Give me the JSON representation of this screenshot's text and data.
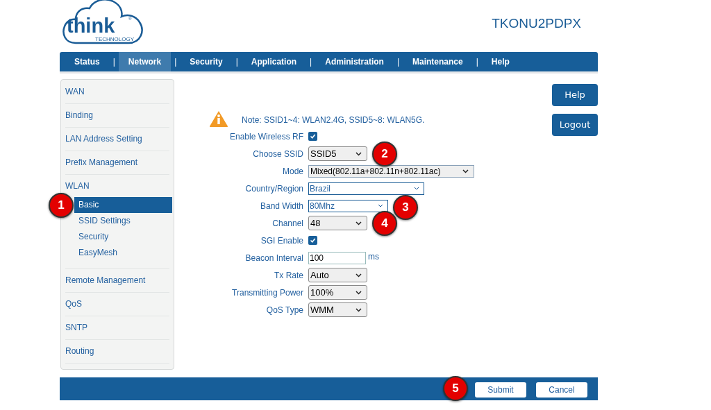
{
  "logo": {
    "name": "think",
    "registered": "®",
    "tagline": "TECHNOLOGY"
  },
  "model": "TKONU2PDPX",
  "nav": {
    "separator": "|",
    "items": [
      {
        "label": "Status",
        "selected": false
      },
      {
        "label": "Network",
        "selected": true
      },
      {
        "label": "Security",
        "selected": false
      },
      {
        "label": "Application",
        "selected": false
      },
      {
        "label": "Administration",
        "selected": false
      },
      {
        "label": "Maintenance",
        "selected": false
      },
      {
        "label": "Help",
        "selected": false
      }
    ]
  },
  "sidebar": {
    "items": [
      {
        "label": "WAN",
        "selected": false
      },
      {
        "label": "Binding",
        "selected": false
      },
      {
        "label": "LAN Address Setting",
        "selected": false
      },
      {
        "label": "Prefix Management",
        "selected": false
      },
      {
        "label": "WLAN",
        "selected": false,
        "children": [
          {
            "label": "Basic",
            "selected": true,
            "marker": "1"
          },
          {
            "label": "SSID Settings",
            "selected": false
          },
          {
            "label": "Security",
            "selected": false
          },
          {
            "label": "EasyMesh",
            "selected": false
          }
        ]
      },
      {
        "label": "Remote Management",
        "selected": false
      },
      {
        "label": "QoS",
        "selected": false
      },
      {
        "label": "SNTP",
        "selected": false
      },
      {
        "label": "Routing",
        "selected": false
      }
    ]
  },
  "side_buttons": [
    "Help",
    "Logout"
  ],
  "note": "Note: SSID1~4: WLAN2.4G, SSID5~8: WLAN5G.",
  "form": [
    {
      "label": "Enable Wireless RF",
      "kind": "checkbox",
      "checked": true
    },
    {
      "label": "Choose SSID",
      "kind": "select",
      "value": "SSID5",
      "marker": "2"
    },
    {
      "label": "Mode",
      "kind": "select",
      "value": "Mixed(802.11a+802.11n+802.11ac)"
    },
    {
      "label": "Country/Region",
      "kind": "dropdown",
      "value": "Brazil"
    },
    {
      "label": "Band Width",
      "kind": "dropdown",
      "value": "80Mhz",
      "marker": "3"
    },
    {
      "label": "Channel",
      "kind": "select",
      "value": "48",
      "marker": "4"
    },
    {
      "label": "SGI Enable",
      "kind": "checkbox",
      "checked": true
    },
    {
      "label": "Beacon Interval",
      "kind": "text",
      "value": "100",
      "unit": "ms"
    },
    {
      "label": "Tx Rate",
      "kind": "select",
      "value": "Auto"
    },
    {
      "label": "Transmitting Power",
      "kind": "select",
      "value": "100%"
    },
    {
      "label": "QoS Type",
      "kind": "select",
      "value": "WMM"
    }
  ],
  "footer": {
    "buttons": [
      {
        "label": "Submit",
        "marker": "5"
      },
      {
        "label": "Cancel"
      }
    ]
  }
}
